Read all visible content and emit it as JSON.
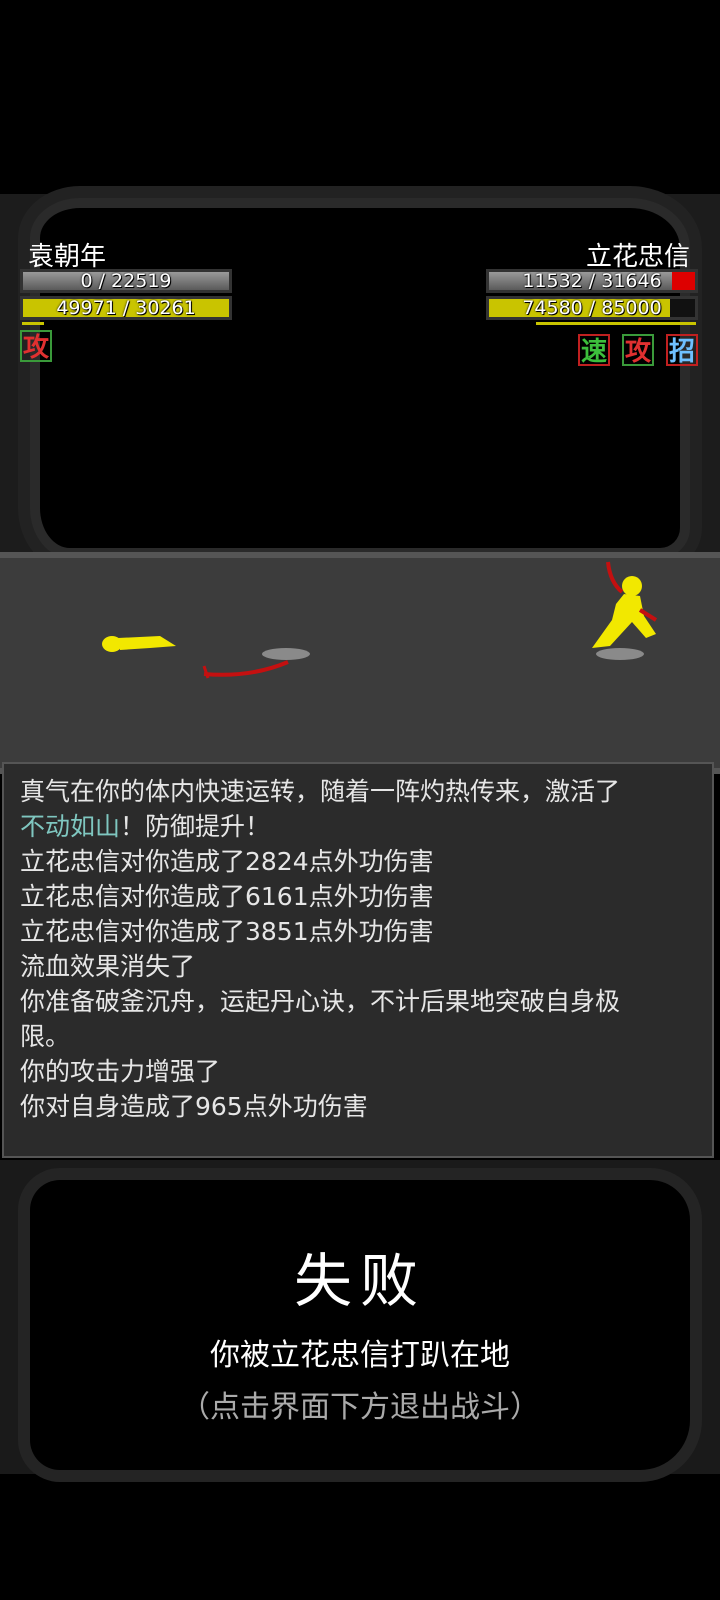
{
  "player": {
    "name": "袁朝年",
    "hp_text": "0 / 22519",
    "hp_fraction": 0,
    "mp_text": "49971 / 30261",
    "mp_fraction": 1,
    "buffs": [
      {
        "label": "攻",
        "color": "#e03030",
        "border": "#3a9a3a"
      }
    ]
  },
  "enemy": {
    "name": "立花忠信",
    "hp_text": "11532 / 31646",
    "hp_fraction": 0.364,
    "mp_text": "74580 / 85000",
    "mp_fraction": 0.877,
    "buffs": [
      {
        "label": "速",
        "color": "#3cbf3c",
        "border": "#c02020"
      },
      {
        "label": "攻",
        "color": "#e03030",
        "border": "#3a9a3a"
      },
      {
        "label": "招",
        "color": "#6fc0ff",
        "border": "#c02020"
      }
    ]
  },
  "log": {
    "lines": [
      {
        "text": "真气在你的体内快速运转，随着一阵灼热传来，激活了",
        "highlight": ""
      },
      {
        "text": "！防御提升！",
        "highlight": "不动如山"
      },
      {
        "text": "立花忠信对你造成了2824点外功伤害",
        "highlight": ""
      },
      {
        "text": "立花忠信对你造成了6161点外功伤害",
        "highlight": ""
      },
      {
        "text": "立花忠信对你造成了3851点外功伤害",
        "highlight": ""
      },
      {
        "text": "流血效果消失了",
        "highlight": ""
      },
      {
        "text": "你准备破釜沉舟，运起丹心诀，不计后果地突破自身极",
        "highlight": ""
      },
      {
        "text": "限。",
        "highlight": ""
      },
      {
        "text": "你的攻击力增强了",
        "highlight": ""
      },
      {
        "text": "你对自身造成了965点外功伤害",
        "highlight": ""
      }
    ]
  },
  "result": {
    "title": "失败",
    "description": "你被立花忠信打趴在地",
    "hint": "（点击界面下方退出战斗）"
  }
}
